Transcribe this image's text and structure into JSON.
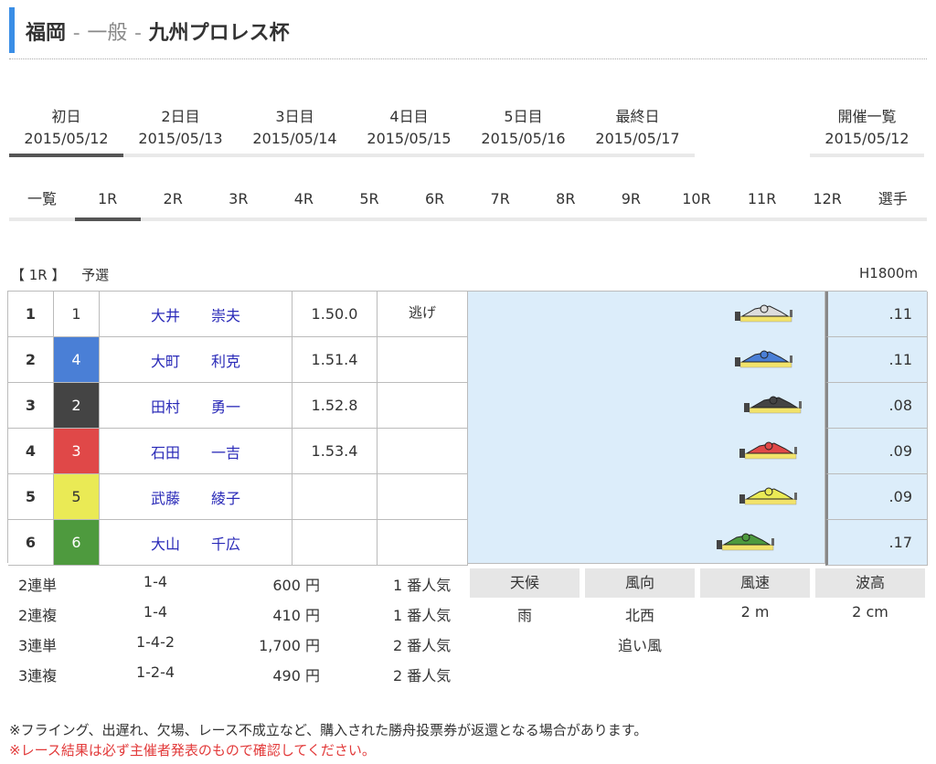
{
  "header": {
    "place": "福岡",
    "sep": "-",
    "grade": "一般",
    "race_name": "九州プロレス杯"
  },
  "day_tabs": [
    {
      "label": "初日",
      "date": "2015/05/12",
      "active": true
    },
    {
      "label": "2日目",
      "date": "2015/05/13",
      "active": false
    },
    {
      "label": "3日目",
      "date": "2015/05/14",
      "active": false
    },
    {
      "label": "4日目",
      "date": "2015/05/15",
      "active": false
    },
    {
      "label": "5日目",
      "date": "2015/05/16",
      "active": false
    },
    {
      "label": "最終日",
      "date": "2015/05/17",
      "active": false
    },
    {
      "label": "開催一覧",
      "date": "2015/05/12",
      "active": false
    }
  ],
  "race_tabs": [
    "一覧",
    "1R",
    "2R",
    "3R",
    "4R",
    "5R",
    "6R",
    "7R",
    "8R",
    "9R",
    "10R",
    "11R",
    "12R",
    "選手"
  ],
  "active_race_tab": "1R",
  "race": {
    "label": "【 1R 】",
    "type": "予選",
    "distance": "H1800m"
  },
  "results": [
    {
      "rank": "1",
      "boat": "1",
      "last": "大井",
      "first": "崇夫",
      "time": "1.50.0",
      "tech": "逃げ",
      "st": ".11"
    },
    {
      "rank": "2",
      "boat": "4",
      "last": "大町",
      "first": "利克",
      "time": "1.51.4",
      "tech": "",
      "st": ".11"
    },
    {
      "rank": "3",
      "boat": "2",
      "last": "田村",
      "first": "勇一",
      "time": "1.52.8",
      "tech": "",
      "st": ".08"
    },
    {
      "rank": "4",
      "boat": "3",
      "last": "石田",
      "first": "一吉",
      "time": "1.53.4",
      "tech": "",
      "st": ".09"
    },
    {
      "rank": "5",
      "boat": "5",
      "last": "武藤",
      "first": "綾子",
      "time": "",
      "tech": "",
      "st": ".09"
    },
    {
      "rank": "6",
      "boat": "6",
      "last": "大山",
      "first": "千広",
      "time": "",
      "tech": "",
      "st": ".17"
    }
  ],
  "boat_colors": {
    "1": {
      "bg": "#ffffff",
      "fg": "#333333"
    },
    "2": {
      "bg": "#444444",
      "fg": "#ffffff"
    },
    "3": {
      "bg": "#e04848",
      "fg": "#ffffff"
    },
    "4": {
      "bg": "#4a7fd6",
      "fg": "#ffffff"
    },
    "5": {
      "bg": "#eaea55",
      "fg": "#333333"
    },
    "6": {
      "bg": "#4e9a3e",
      "fg": "#ffffff"
    }
  },
  "payouts": [
    {
      "kind": "2連単",
      "combo": "1-4",
      "amount": "600 円",
      "pop": "1 番人気"
    },
    {
      "kind": "2連複",
      "combo": "1-4",
      "amount": "410 円",
      "pop": "1 番人気"
    },
    {
      "kind": "3連単",
      "combo": "1-4-2",
      "amount": "1,700 円",
      "pop": "2 番人気"
    },
    {
      "kind": "3連複",
      "combo": "1-2-4",
      "amount": "490 円",
      "pop": "2 番人気"
    }
  ],
  "weather": {
    "headers": [
      "天候",
      "風向",
      "風速",
      "波高"
    ],
    "values": [
      "雨",
      "北西",
      "2 m",
      "2 cm"
    ],
    "wind_note": "追い風"
  },
  "notes": {
    "refund": "※フライング、出遅れ、欠場、レース不成立など、購入された勝舟投票券が返還となる場合があります。",
    "confirm": "※レース結果は必ず主催者発表のもので確認してください。"
  }
}
